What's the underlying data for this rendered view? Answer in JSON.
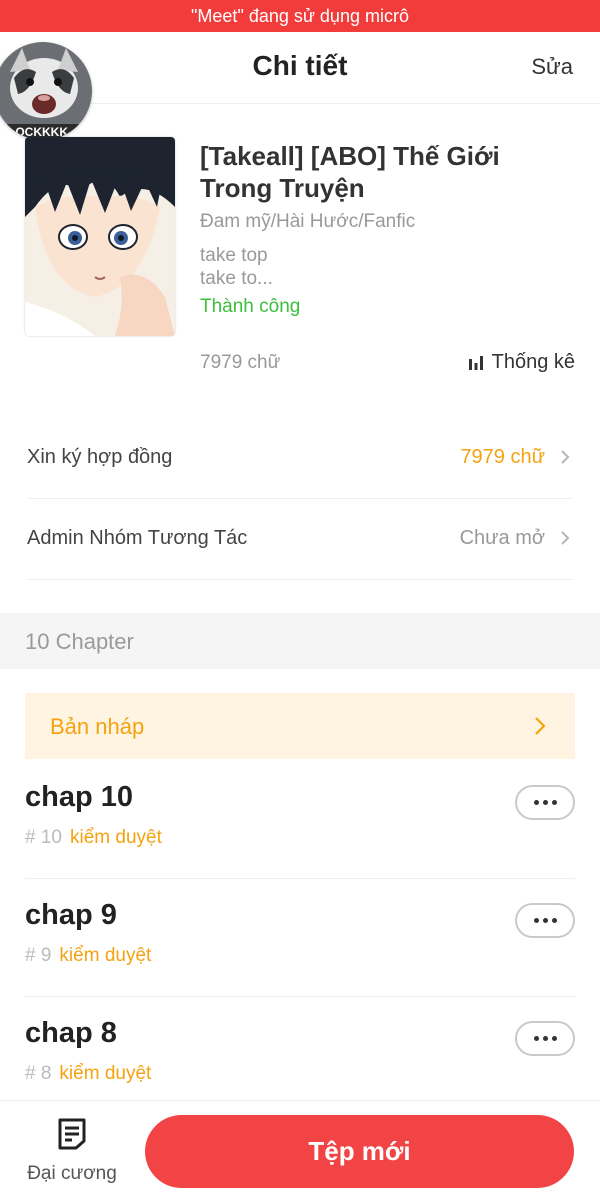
{
  "status_bar": {
    "mic_notice": "\"Meet\" đang sử dụng micrô"
  },
  "header": {
    "title": "Chi tiết",
    "edit_label": "Sửa"
  },
  "avatar": {
    "caption": "LOCKKKK"
  },
  "book": {
    "title": "[Takeall] [ABO] Thế Giới Trong Truyện",
    "genre": "Đam mỹ/Hài Hước/Fanfic",
    "description_lines": [
      "take top",
      "take to..."
    ],
    "status": "Thành công",
    "word_count": "7979 chữ",
    "stats_label": "Thống kê"
  },
  "settings": [
    {
      "label": "Xin ký hợp đồng",
      "value": "7979 chữ"
    },
    {
      "label": "Admin Nhóm Tương Tác",
      "value": "Chưa mở"
    }
  ],
  "chapters_section": {
    "count_label": "10 Chapter",
    "draft_label": "Bản nháp",
    "items": [
      {
        "name": "chap 10",
        "number": "# 10",
        "status": "kiểm duyệt"
      },
      {
        "name": "chap 9",
        "number": "# 9",
        "status": "kiểm duyệt"
      },
      {
        "name": "chap 8",
        "number": "# 8",
        "status": "kiểm duyệt"
      }
    ]
  },
  "bottom_bar": {
    "outline_label": "Đại cương",
    "new_file_label": "Tệp mới"
  },
  "colors": {
    "accent_red": "#f24444",
    "status_orange": "#f5a210",
    "success_green": "#3cbf3c",
    "mic_bar": "#f23b3b"
  }
}
